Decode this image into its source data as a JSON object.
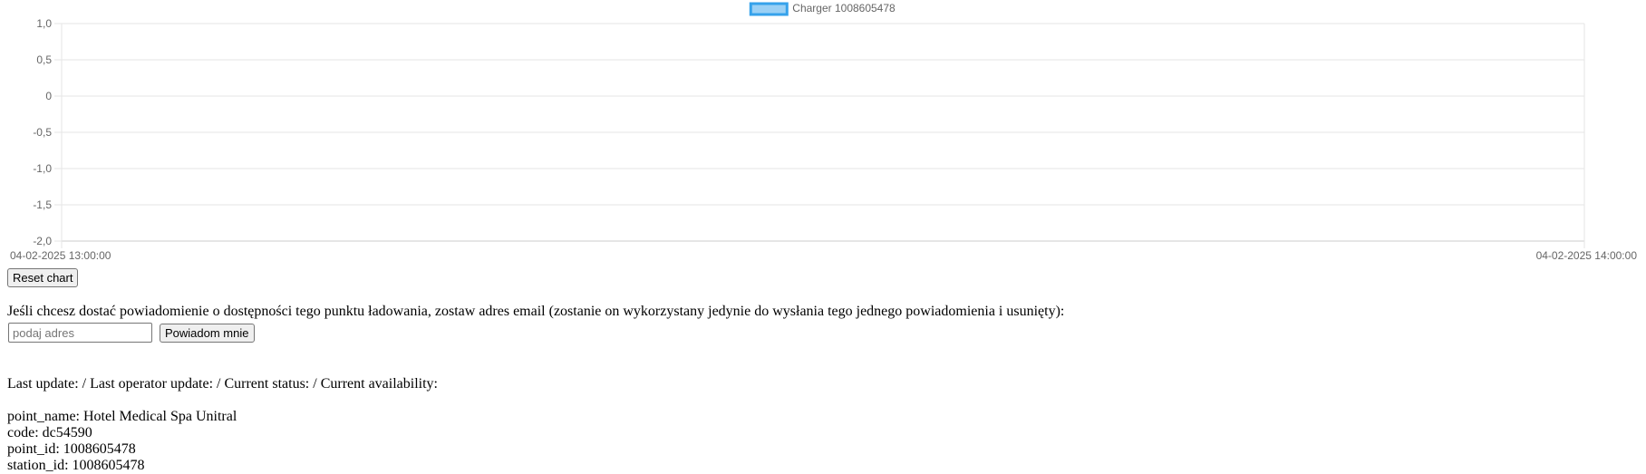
{
  "chart_data": {
    "type": "line",
    "series": [
      {
        "name": "Charger 1008605478",
        "values": []
      }
    ],
    "x": [],
    "xlim": [
      "04-02-2025 13:00:00",
      "04-02-2025 14:00:00"
    ],
    "x_tick_labels": [
      "04-02-2025 13:00:00",
      "04-02-2025 14:00:00"
    ],
    "ylim": [
      -2.0,
      1.0
    ],
    "y_tick_labels": [
      "1,0",
      "0,5",
      "0",
      "-0,5",
      "-1,0",
      "-1,5",
      "-2,0"
    ],
    "grid": true,
    "legend_position": "top-center",
    "series_color": "#36a2eb",
    "series_fill": "#9ad0f5",
    "title": "",
    "xlabel": "",
    "ylabel": ""
  },
  "controls": {
    "reset_label": "Reset chart",
    "notify_text": "Jeśli chcesz dostać powiadomienie o dostępności tego punktu ładowania, zostaw adres email (zostanie on wykorzystany jedynie do wysłania tego jednego powiadomienia i usunięty):",
    "email_placeholder": "podaj adres",
    "email_value": "",
    "notify_button_label": "Powiadom mnie"
  },
  "status": {
    "line": "Last update: / Last operator update: / Current status: / Current availability:"
  },
  "info": {
    "point_name": "point_name: Hotel Medical Spa Unitral",
    "code": "code: dc54590",
    "point_id": "point_id: 1008605478",
    "station_id": "station_id: 1008605478"
  }
}
